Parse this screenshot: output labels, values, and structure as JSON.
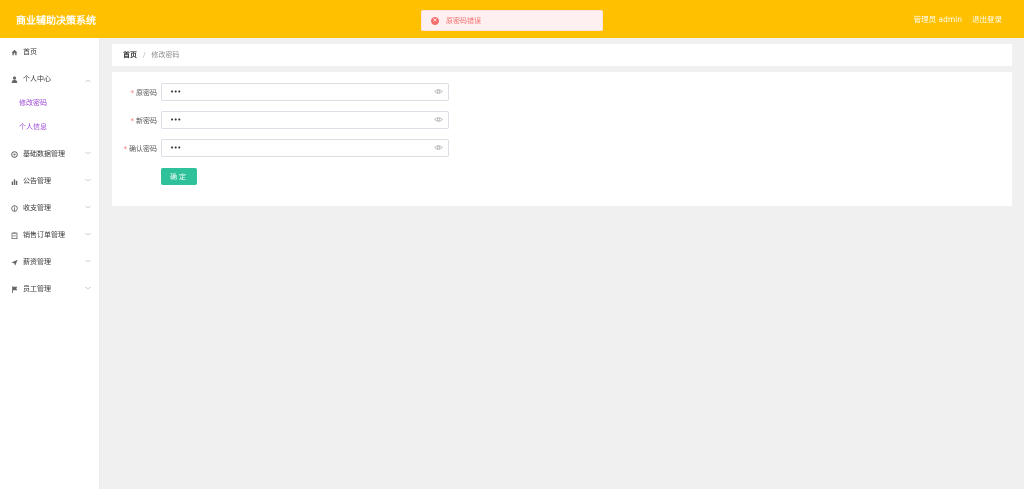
{
  "header": {
    "app_title": "商业辅助决策系统",
    "user_label": "管理员 admin",
    "logout_label": "退出登录",
    "background_color": "#ffc000"
  },
  "toast": {
    "message": "原密码错误",
    "icon": "error-circle-icon",
    "color": "#f56c6c"
  },
  "sidebar": {
    "items": [
      {
        "label": "首页",
        "icon": "home-icon"
      },
      {
        "label": "个人中心",
        "icon": "user-icon",
        "expanded": true
      },
      {
        "label": "基础数据管理",
        "icon": "gear-icon"
      },
      {
        "label": "公告管理",
        "icon": "bar-chart-icon"
      },
      {
        "label": "收支管理",
        "icon": "info-icon"
      },
      {
        "label": "销售订单管理",
        "icon": "clipboard-icon"
      },
      {
        "label": "薪资管理",
        "icon": "send-icon"
      },
      {
        "label": "员工管理",
        "icon": "flag-icon"
      }
    ],
    "sub_items": [
      {
        "label": "修改密码"
      },
      {
        "label": "个人信息"
      }
    ],
    "accent_color": "#9a3fd6"
  },
  "breadcrumb": {
    "home": "首页",
    "separator": "/",
    "current": "修改密码"
  },
  "form": {
    "fields": [
      {
        "label": "原密码",
        "value": "•••",
        "required": true
      },
      {
        "label": "新密码",
        "value": "•••",
        "required": true
      },
      {
        "label": "确认密码",
        "value": "•••",
        "required": true
      }
    ],
    "submit_label": "确定",
    "submit_color": "#2fc29a"
  }
}
